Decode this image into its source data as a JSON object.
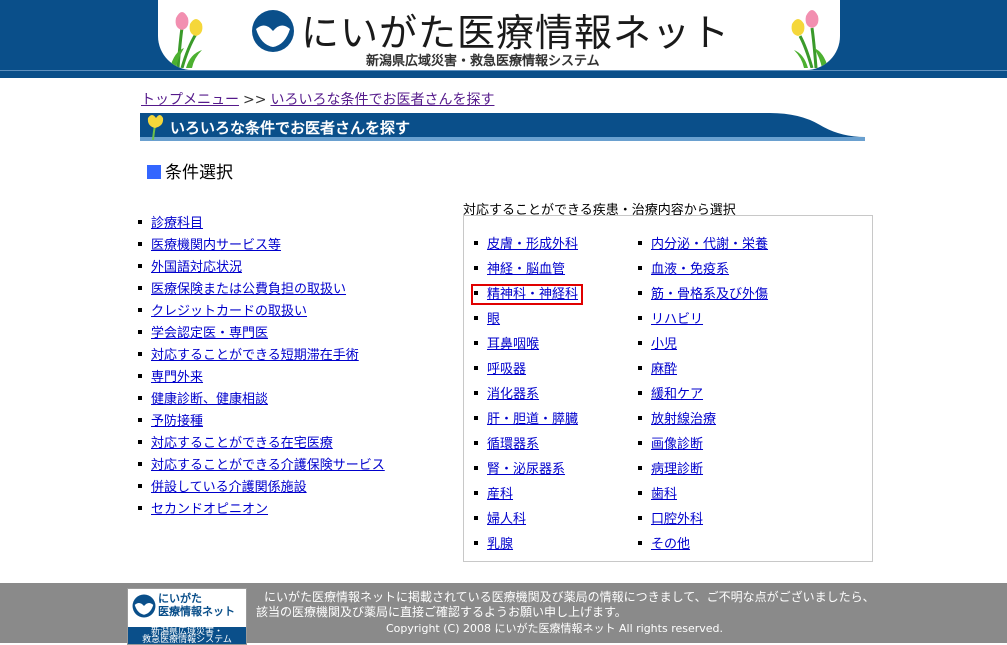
{
  "header": {
    "title": "にいがた医療情報ネット",
    "subtitle": "新潟県広域災害・救急医療情報システム"
  },
  "breadcrumb": {
    "top": "トップメニュー",
    "separator": ">>",
    "current": "いろいろな条件でお医者さんを探す"
  },
  "section_bar": {
    "title": "いろいろな条件でお医者さんを探す"
  },
  "condition": {
    "heading": "条件選択"
  },
  "left_list": [
    "診療科目",
    "医療機関内サービス等",
    "外国語対応状況",
    "医療保険または公費負担の取扱い",
    "クレジットカードの取扱い",
    "学会認定医・専門医",
    "対応することができる短期滞在手術",
    "専門外来",
    "健康診断、健康相談",
    "予防接種",
    "対応することができる在宅医療",
    "対応することができる介護保険サービス",
    "併設している介護関係施設",
    "セカンドオピニオン"
  ],
  "right_panel": {
    "caption": "対応することができる疾患・治療内容から選択",
    "column_a": [
      "皮膚・形成外科",
      "神経・脳血管",
      "精神科・神経科",
      "眼",
      "耳鼻咽喉",
      "呼吸器",
      "消化器系",
      "肝・胆道・膵臓",
      "循環器系",
      "腎・泌尿器系",
      "産科",
      "婦人科",
      "乳腺"
    ],
    "column_b": [
      "内分泌・代謝・栄養",
      "血液・免疫系",
      "筋・骨格系及び外傷",
      "リハビリ",
      "小児",
      "麻酔",
      "緩和ケア",
      "放射線治療",
      "画像診断",
      "病理診断",
      "歯科",
      "口腔外科",
      "その他"
    ]
  },
  "footer": {
    "logo_name_1": "にいがた",
    "logo_name_2": "医療情報ネット",
    "logo_sub_1": "新潟県広域災害・",
    "logo_sub_2": "救急医療情報システム",
    "notice_1": "にいがた医療情報ネットに掲載されている医療機関及び薬局の情報につきまして、ご不明な点がございましたら、",
    "notice_2": "該当の医療機関及び薬局に直接ご確認するようお願い申し上げます。",
    "copyright": "Copyright (C) 2008 にいがた医療情報ネット All rights reserved."
  },
  "colors": {
    "header_blue": "#0a4f8a",
    "link": "#0000cc",
    "visited_link": "#551a8b",
    "heading_square": "#3366ff",
    "highlight_border": "#e00000",
    "footer_gray": "#8a8a8a"
  }
}
